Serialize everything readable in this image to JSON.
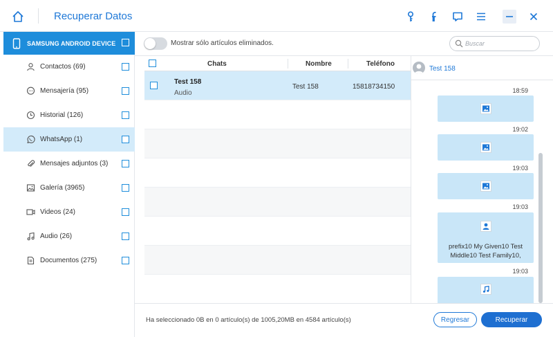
{
  "app": {
    "title": "Recuperar Datos"
  },
  "titlebar": {
    "icons": [
      "home-icon",
      "key-icon",
      "facebook-icon",
      "feedback-icon",
      "menu-icon",
      "minimize-icon",
      "close-icon"
    ],
    "accent": "#1e78d7"
  },
  "sidebar": {
    "device": "SAMSUNG ANDROID DEVICE",
    "items": [
      {
        "label": "Contactos (69)",
        "icon": "contact-icon"
      },
      {
        "label": "Mensajería (95)",
        "icon": "message-icon"
      },
      {
        "label": "Historial (126)",
        "icon": "clock-icon"
      },
      {
        "label": "WhatsApp (1)",
        "icon": "whatsapp-icon",
        "active": true
      },
      {
        "label": "Mensajes adjuntos (3)",
        "icon": "attachment-icon"
      },
      {
        "label": "Galería (3965)",
        "icon": "image-icon"
      },
      {
        "label": "Videos (24)",
        "icon": "video-icon"
      },
      {
        "label": "Audio (26)",
        "icon": "music-icon"
      },
      {
        "label": "Documentos (275)",
        "icon": "document-icon"
      }
    ]
  },
  "toolbar": {
    "toggle_label": "Mostrar sólo artículos eliminados.",
    "search_placeholder": "Buscar"
  },
  "table": {
    "headers": {
      "chats": "Chats",
      "name": "Nombre",
      "phone": "Teléfono"
    },
    "rows": [
      {
        "title": "Test 158",
        "subtitle": "Audio",
        "name": "Test 158",
        "phone": "15818734150"
      }
    ]
  },
  "chat": {
    "contact": "Test 158",
    "messages": [
      {
        "time": "18:59"
      },
      {
        "type": "image",
        "time": "19:02"
      },
      {
        "type": "image",
        "time": "19:03"
      },
      {
        "type": "image",
        "time": "19:03"
      },
      {
        "type": "contact",
        "text": "prefix10 My Given10 Test Middle10 Test Family10,",
        "time": "19:03"
      },
      {
        "type": "audio"
      }
    ]
  },
  "footer": {
    "status": "Ha seleccionado 0B en 0 artículo(s) de 1005,20MB en 4584 artículo(s)",
    "back_label": "Regresar",
    "recover_label": "Recuperar"
  },
  "colors": {
    "accent": "#1e8ddb",
    "selected_row": "#d3ebfa",
    "bubble": "#c9e6f8",
    "primary_button": "#1e6fd1"
  }
}
